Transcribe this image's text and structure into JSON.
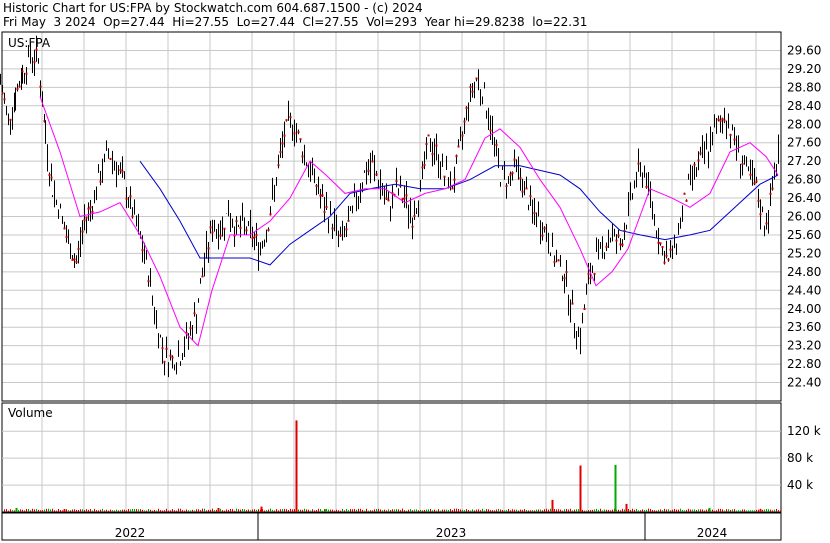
{
  "header": {
    "line1": "Historic Chart for US:FPA by Stockwatch.com 604.687.1500 - (c) 2024",
    "line2": "Fri May  3 2024  Op=27.44  Hi=27.55  Lo=27.44  Cl=27.55  Vol=293  Year hi=29.8238  lo=22.31"
  },
  "chart_data": [
    {
      "type": "line",
      "panel": "price",
      "legend_label": "US:FPA",
      "ylim": [
        22.0,
        30.0
      ],
      "y_ticks": [
        "29.60",
        "29.20",
        "28.80",
        "28.40",
        "28.00",
        "27.60",
        "27.20",
        "26.80",
        "26.40",
        "26.00",
        "25.60",
        "25.20",
        "24.80",
        "24.40",
        "24.00",
        "23.60",
        "23.20",
        "22.80",
        "22.40"
      ],
      "x_ticks": [
        "2022",
        "2023",
        "2024"
      ],
      "grid": true,
      "colors": {
        "bar": "#000000",
        "close_dot": "#cc0000",
        "ma_short": "#ff00ff",
        "ma_long": "#0000cc",
        "grid": "#c8c8c8"
      },
      "price_points": [
        [
          0,
          28.9
        ],
        [
          8,
          28.1
        ],
        [
          15,
          28.6
        ],
        [
          22,
          29.1
        ],
        [
          30,
          29.5
        ],
        [
          38,
          29.4
        ],
        [
          45,
          27.8
        ],
        [
          52,
          26.6
        ],
        [
          60,
          26.1
        ],
        [
          68,
          25.4
        ],
        [
          76,
          25.0
        ],
        [
          84,
          25.9
        ],
        [
          92,
          26.3
        ],
        [
          100,
          26.9
        ],
        [
          108,
          27.4
        ],
        [
          116,
          27.1
        ],
        [
          124,
          26.7
        ],
        [
          132,
          26.1
        ],
        [
          140,
          25.5
        ],
        [
          148,
          24.8
        ],
        [
          156,
          23.7
        ],
        [
          164,
          23.0
        ],
        [
          172,
          22.9
        ],
        [
          180,
          23.0
        ],
        [
          188,
          23.4
        ],
        [
          196,
          23.9
        ],
        [
          204,
          25.0
        ],
        [
          212,
          25.8
        ],
        [
          220,
          25.7
        ],
        [
          228,
          26.1
        ],
        [
          236,
          25.7
        ],
        [
          244,
          25.8
        ],
        [
          252,
          25.6
        ],
        [
          260,
          25.3
        ],
        [
          268,
          25.9
        ],
        [
          276,
          26.8
        ],
        [
          284,
          27.8
        ],
        [
          292,
          28.1
        ],
        [
          300,
          27.6
        ],
        [
          308,
          27.1
        ],
        [
          316,
          26.7
        ],
        [
          324,
          26.2
        ],
        [
          332,
          25.9
        ],
        [
          340,
          25.5
        ],
        [
          348,
          25.8
        ],
        [
          356,
          26.4
        ],
        [
          364,
          26.9
        ],
        [
          372,
          27.1
        ],
        [
          380,
          26.7
        ],
        [
          388,
          26.2
        ],
        [
          396,
          26.6
        ],
        [
          404,
          26.4
        ],
        [
          412,
          26.0
        ],
        [
          420,
          26.6
        ],
        [
          428,
          27.6
        ],
        [
          436,
          27.4
        ],
        [
          444,
          26.9
        ],
        [
          452,
          26.7
        ],
        [
          460,
          27.5
        ],
        [
          468,
          28.5
        ],
        [
          476,
          29.0
        ],
        [
          484,
          28.6
        ],
        [
          492,
          27.8
        ],
        [
          500,
          26.9
        ],
        [
          508,
          26.8
        ],
        [
          516,
          27.1
        ],
        [
          524,
          26.6
        ],
        [
          532,
          26.1
        ],
        [
          540,
          25.9
        ],
        [
          548,
          25.5
        ],
        [
          556,
          25.0
        ],
        [
          564,
          24.8
        ],
        [
          572,
          23.9
        ],
        [
          580,
          23.4
        ],
        [
          588,
          24.6
        ],
        [
          596,
          25.1
        ],
        [
          604,
          25.4
        ],
        [
          612,
          25.6
        ],
        [
          620,
          25.4
        ],
        [
          628,
          26.1
        ],
        [
          636,
          26.9
        ],
        [
          644,
          27.0
        ],
        [
          652,
          26.2
        ],
        [
          660,
          25.4
        ],
        [
          668,
          25.0
        ],
        [
          676,
          25.5
        ],
        [
          684,
          26.3
        ],
        [
          692,
          26.9
        ],
        [
          700,
          27.2
        ],
        [
          708,
          27.5
        ],
        [
          716,
          27.9
        ],
        [
          724,
          28.2
        ],
        [
          732,
          27.8
        ],
        [
          740,
          27.3
        ],
        [
          748,
          26.9
        ],
        [
          756,
          26.6
        ],
        [
          764,
          25.8
        ],
        [
          770,
          26.3
        ],
        [
          776,
          27.2
        ],
        [
          780,
          27.55
        ]
      ],
      "ma_short_points": [
        [
          40,
          28.6
        ],
        [
          60,
          27.4
        ],
        [
          80,
          26.0
        ],
        [
          100,
          26.1
        ],
        [
          120,
          26.3
        ],
        [
          140,
          25.6
        ],
        [
          160,
          24.7
        ],
        [
          180,
          23.6
        ],
        [
          198,
          23.2
        ],
        [
          212,
          24.4
        ],
        [
          230,
          25.6
        ],
        [
          250,
          25.6
        ],
        [
          270,
          25.9
        ],
        [
          290,
          26.4
        ],
        [
          310,
          27.2
        ],
        [
          326,
          26.9
        ],
        [
          345,
          26.5
        ],
        [
          365,
          26.6
        ],
        [
          385,
          26.6
        ],
        [
          405,
          26.3
        ],
        [
          425,
          26.5
        ],
        [
          445,
          26.6
        ],
        [
          465,
          26.8
        ],
        [
          485,
          27.7
        ],
        [
          500,
          27.9
        ],
        [
          520,
          27.5
        ],
        [
          540,
          26.8
        ],
        [
          560,
          26.2
        ],
        [
          580,
          25.3
        ],
        [
          596,
          24.5
        ],
        [
          612,
          24.8
        ],
        [
          628,
          25.3
        ],
        [
          650,
          26.6
        ],
        [
          672,
          26.4
        ],
        [
          690,
          26.2
        ],
        [
          710,
          26.5
        ],
        [
          730,
          27.4
        ],
        [
          750,
          27.6
        ],
        [
          766,
          27.3
        ],
        [
          778,
          26.9
        ]
      ],
      "ma_long_points": [
        [
          140,
          27.2
        ],
        [
          160,
          26.6
        ],
        [
          180,
          25.9
        ],
        [
          200,
          25.1
        ],
        [
          220,
          25.1
        ],
        [
          250,
          25.1
        ],
        [
          270,
          24.95
        ],
        [
          290,
          25.4
        ],
        [
          310,
          25.7
        ],
        [
          330,
          26.0
        ],
        [
          350,
          26.5
        ],
        [
          370,
          26.6
        ],
        [
          395,
          26.7
        ],
        [
          420,
          26.6
        ],
        [
          445,
          26.6
        ],
        [
          470,
          26.8
        ],
        [
          495,
          27.1
        ],
        [
          520,
          27.1
        ],
        [
          540,
          27.0
        ],
        [
          560,
          26.9
        ],
        [
          580,
          26.6
        ],
        [
          600,
          26.1
        ],
        [
          620,
          25.7
        ],
        [
          640,
          25.6
        ],
        [
          665,
          25.5
        ],
        [
          690,
          25.6
        ],
        [
          710,
          25.7
        ],
        [
          735,
          26.2
        ],
        [
          760,
          26.7
        ],
        [
          778,
          26.9
        ]
      ]
    },
    {
      "type": "bar",
      "panel": "volume",
      "title": "Volume",
      "y_ticks": [
        "120 k",
        "80 k",
        "40 k"
      ],
      "ylim": [
        0,
        150
      ],
      "spikes": [
        [
          296,
          136
        ],
        [
          325,
          4
        ],
        [
          552,
          18
        ],
        [
          580,
          69
        ],
        [
          615,
          70
        ],
        [
          626,
          12
        ],
        [
          218,
          6
        ],
        [
          16,
          6
        ],
        [
          64,
          4
        ],
        [
          261,
          8
        ],
        [
          709,
          6
        ],
        [
          760,
          4
        ]
      ],
      "baseline": 2
    }
  ]
}
